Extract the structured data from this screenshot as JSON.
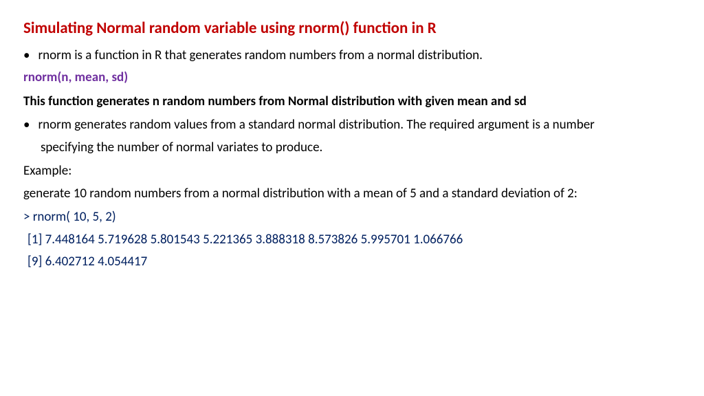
{
  "title": "Simulating Normal random variable using rnorm() function in R",
  "bullet1": "rnorm is a function in R that generates random numbers from a normal distribution.",
  "syntax": "rnorm(n, mean, sd)",
  "description": "This function generates n random numbers from Normal distribution with given mean and sd",
  "bullet2_line1": "rnorm generates random values from a standard normal distribution. The required argument is a number",
  "bullet2_line2": "specifying the number of normal variates to produce.",
  "example_label": "Example:",
  "example_text": "generate 10 random numbers from a normal distribution with a mean of 5 and a standard deviation of 2:",
  "code": "> rnorm( 10, 5, 2)",
  "output1": "[1] 7.448164 5.719628 5.801543 5.221365 3.888318 8.573826 5.995701 1.066766",
  "output2": "[9] 6.402712 4.054417",
  "bullet_char": "•"
}
